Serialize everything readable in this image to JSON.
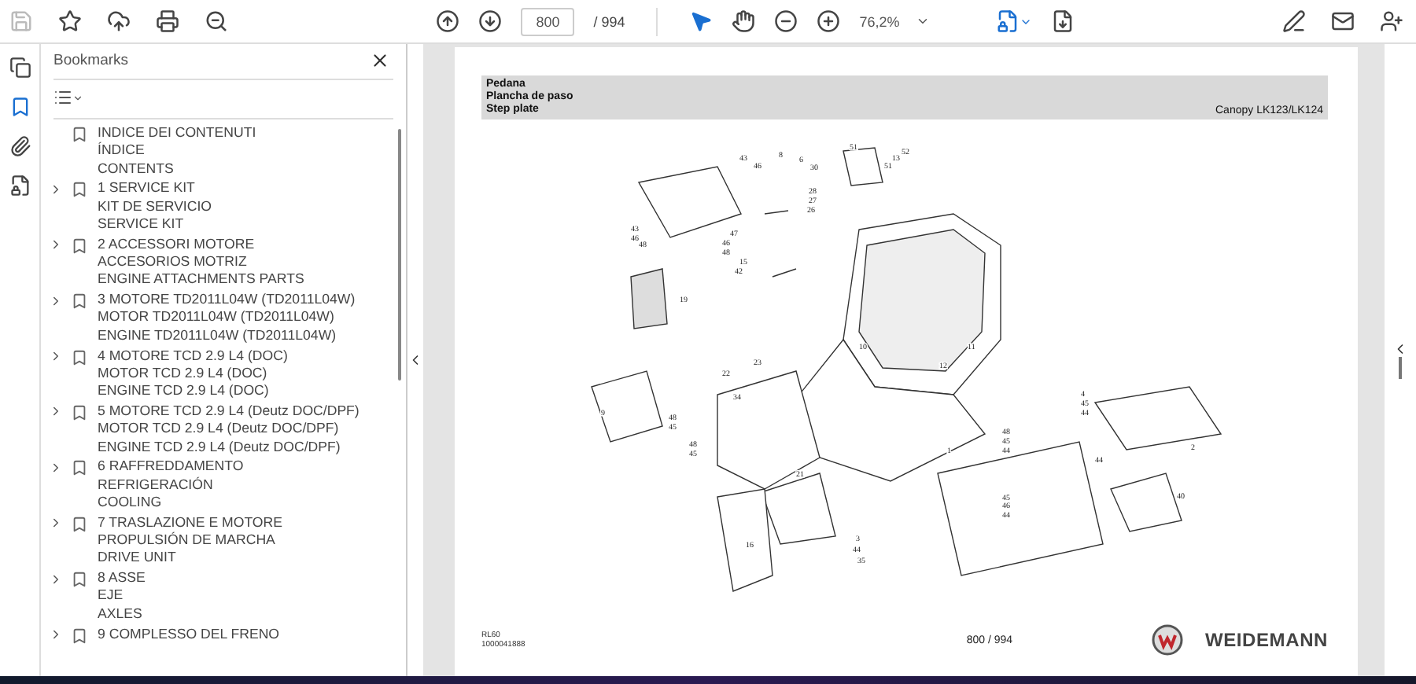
{
  "toolbar": {
    "page_input": "800",
    "page_total": "/ 994",
    "zoom": "76,2%"
  },
  "sidebar": {
    "title": "Bookmarks",
    "bookmarks": [
      {
        "lines": [
          "INDICE DEI CONTENUTI",
          "ÍNDICE",
          "CONTENTS"
        ],
        "has_children": false
      },
      {
        "lines": [
          "1 SERVICE KIT",
          "KIT DE SERVICIO",
          "SERVICE KIT"
        ],
        "has_children": true
      },
      {
        "lines": [
          "2 ACCESSORI MOTORE",
          "ACCESORIOS MOTRIZ",
          "ENGINE ATTACHMENTS PARTS"
        ],
        "has_children": true
      },
      {
        "lines": [
          "3 MOTORE TD2011L04W (TD2011L04W)",
          "MOTOR TD2011L04W (TD2011L04W)",
          "ENGINE TD2011L04W (TD2011L04W)"
        ],
        "has_children": true
      },
      {
        "lines": [
          "4 MOTORE TCD 2.9 L4 (DOC)",
          "MOTOR TCD 2.9 L4 (DOC)",
          "ENGINE TCD 2.9 L4 (DOC)"
        ],
        "has_children": true
      },
      {
        "lines": [
          "5 MOTORE TCD 2.9 L4 (Deutz DOC/DPF)",
          "MOTOR TCD 2.9 L4 (Deutz DOC/DPF)",
          "ENGINE TCD 2.9 L4 (Deutz DOC/DPF)"
        ],
        "has_children": true
      },
      {
        "lines": [
          "6 RAFFREDDAMENTO",
          "REFRIGERACIÓN",
          "COOLING"
        ],
        "has_children": true
      },
      {
        "lines": [
          "7 TRASLAZIONE E MOTORE",
          "PROPULSIÓN DE MARCHA",
          "DRIVE UNIT"
        ],
        "has_children": true
      },
      {
        "lines": [
          "8 ASSE",
          "EJE",
          "AXLES"
        ],
        "has_children": true
      },
      {
        "lines": [
          "9 COMPLESSO DEL FRENO"
        ],
        "has_children": true
      }
    ]
  },
  "page": {
    "header_lines": [
      "Pedana",
      "Plancha de paso",
      "Step plate"
    ],
    "model": "Canopy LK123/LK124",
    "callouts": [
      "43",
      "46",
      "8",
      "6",
      "30",
      "51",
      "13",
      "52",
      "51",
      "28",
      "27",
      "26",
      "43",
      "46",
      "48",
      "47",
      "46",
      "48",
      "15",
      "42",
      "19",
      "23",
      "22",
      "34",
      "9",
      "48",
      "45",
      "48",
      "45",
      "21",
      "10",
      "11",
      "12",
      "1",
      "4",
      "45",
      "44",
      "2",
      "48",
      "45",
      "44",
      "44",
      "45",
      "46",
      "44",
      "40",
      "16",
      "3",
      "44",
      "35"
    ],
    "footer_code": "RL60",
    "footer_number": "1000041888",
    "page_number": "800 / 994",
    "brand": "WEIDEMANN"
  }
}
